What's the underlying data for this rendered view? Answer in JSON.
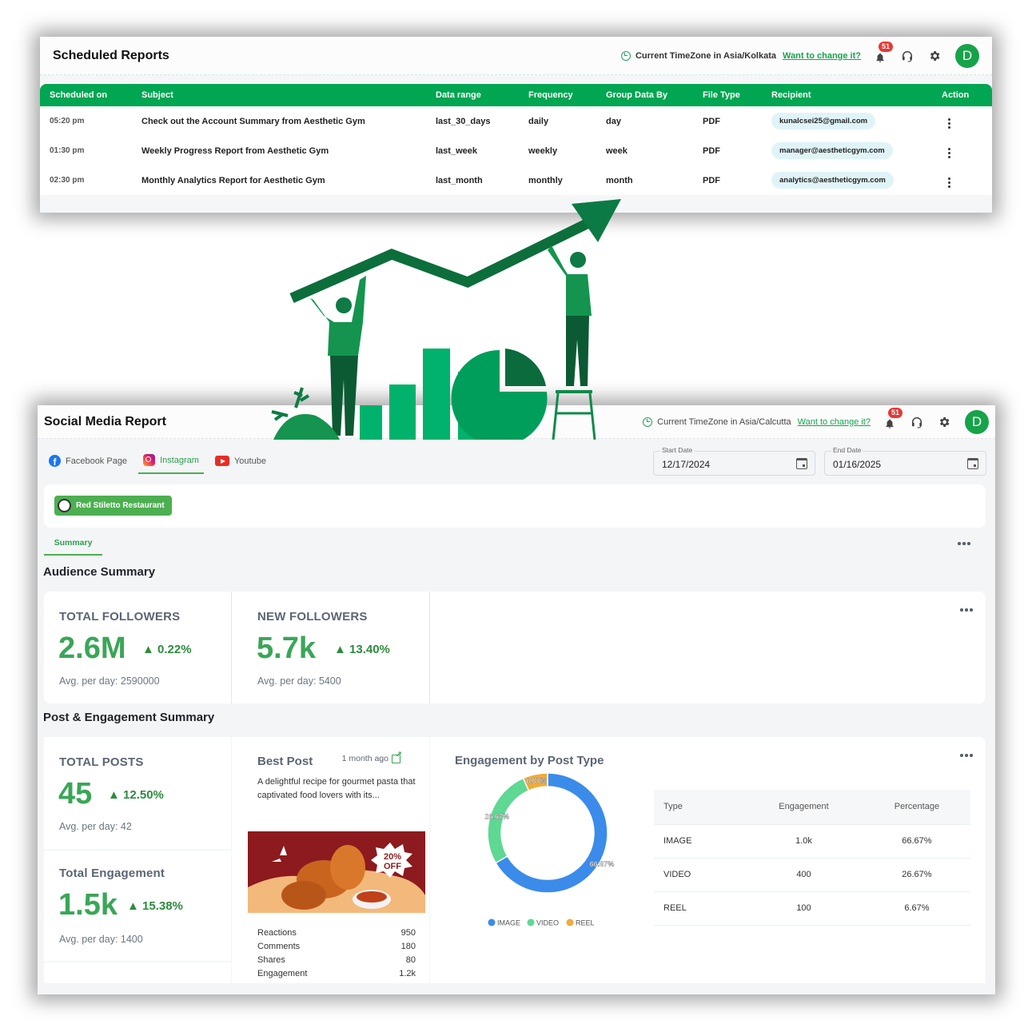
{
  "scheduled_reports": {
    "title": "Scheduled Reports",
    "timezone_text": "Current TimeZone in Asia/Kolkata",
    "timezone_link": "Want to change it?",
    "notification_count": "51",
    "avatar_initial": "D",
    "columns": [
      "Scheduled on",
      "Subject",
      "Data range",
      "Frequency",
      "Group Data By",
      "File Type",
      "Recipient",
      "Action"
    ],
    "rows": [
      {
        "time": "05:20 pm",
        "subject": "Check out the Account Summary from Aesthetic Gym",
        "range": "last_30_days",
        "frequency": "daily",
        "group": "day",
        "file_type": "PDF",
        "recipient": "kunalcsei25@gmail.com"
      },
      {
        "time": "01:30 pm",
        "subject": "Weekly Progress Report from Aesthetic Gym",
        "range": "last_week",
        "frequency": "weekly",
        "group": "week",
        "file_type": "PDF",
        "recipient": "manager@aestheticgym.com"
      },
      {
        "time": "02:30 pm",
        "subject": "Monthly Analytics Report for Aesthetic Gym",
        "range": "last_month",
        "frequency": "monthly",
        "group": "month",
        "file_type": "PDF",
        "recipient": "analytics@aestheticgym.com"
      }
    ]
  },
  "social_report": {
    "title": "Social Media Report",
    "timezone_text": "Current TimeZone in Asia/Calcutta",
    "timezone_link": "Want to change it?",
    "notification_count": "51",
    "avatar_initial": "D",
    "platform_tabs": [
      {
        "label": "Facebook Page",
        "icon": "facebook-icon",
        "active": false
      },
      {
        "label": "Instagram",
        "icon": "instagram-icon",
        "active": true
      },
      {
        "label": "Youtube",
        "icon": "youtube-icon",
        "active": false
      }
    ],
    "start_date": {
      "label": "Start Date",
      "value": "12/17/2024"
    },
    "end_date": {
      "label": "End Date",
      "value": "01/16/2025"
    },
    "account_name": "Red Stiletto Restaurant",
    "summary_tab": "Summary",
    "audience_title": "Audience Summary",
    "total_followers": {
      "label": "TOTAL FOLLOWERS",
      "value": "2.6M",
      "change": "▲ 0.22%",
      "avg": "Avg. per day: 2590000"
    },
    "new_followers": {
      "label": "NEW FOLLOWERS",
      "value": "5.7k",
      "change": "▲ 13.40%",
      "avg": "Avg. per day: 5400"
    },
    "post_title": "Post & Engagement Summary",
    "total_posts": {
      "label": "TOTAL POSTS",
      "value": "45",
      "change": "▲ 12.50%",
      "avg": "Avg. per day: 42"
    },
    "total_engagement": {
      "label": "Total Engagement",
      "value": "1.5k",
      "change": "▲ 15.38%",
      "avg": "Avg. per day: 1400"
    },
    "best_post": {
      "title": "Best Post",
      "ago": "1 month ago",
      "text": "A delightful recipe for gourmet pasta that captivated food lovers with its...",
      "image_badge": "20% OFF",
      "stats": [
        {
          "label": "Reactions",
          "value": "950"
        },
        {
          "label": "Comments",
          "value": "180"
        },
        {
          "label": "Shares",
          "value": "80"
        },
        {
          "label": "Engagement",
          "value": "1.2k"
        }
      ]
    },
    "engagement_by_type": {
      "title": "Engagement by Post Type",
      "table_headers": [
        "Type",
        "Engagement",
        "Percentage"
      ],
      "rows": [
        {
          "type": "IMAGE",
          "engagement": "1.0k",
          "percentage": "66.67%"
        },
        {
          "type": "VIDEO",
          "engagement": "400",
          "percentage": "26.67%"
        },
        {
          "type": "REEL",
          "engagement": "100",
          "percentage": "6.67%"
        }
      ]
    }
  },
  "chart_data": {
    "type": "pie",
    "title": "Engagement by Post Type",
    "categories": [
      "IMAGE",
      "VIDEO",
      "REEL"
    ],
    "values": [
      66.67,
      26.67,
      6.67
    ],
    "labels": [
      "66.67%",
      "26.67%",
      "6.67%"
    ],
    "colors": [
      "#3b8beb",
      "#5ed893",
      "#f2aa3a"
    ],
    "donut": true,
    "legend": "bottom"
  },
  "colors": {
    "brand_green": "#00a651",
    "metric_green": "#3aa657",
    "badge_red": "#e53935"
  }
}
